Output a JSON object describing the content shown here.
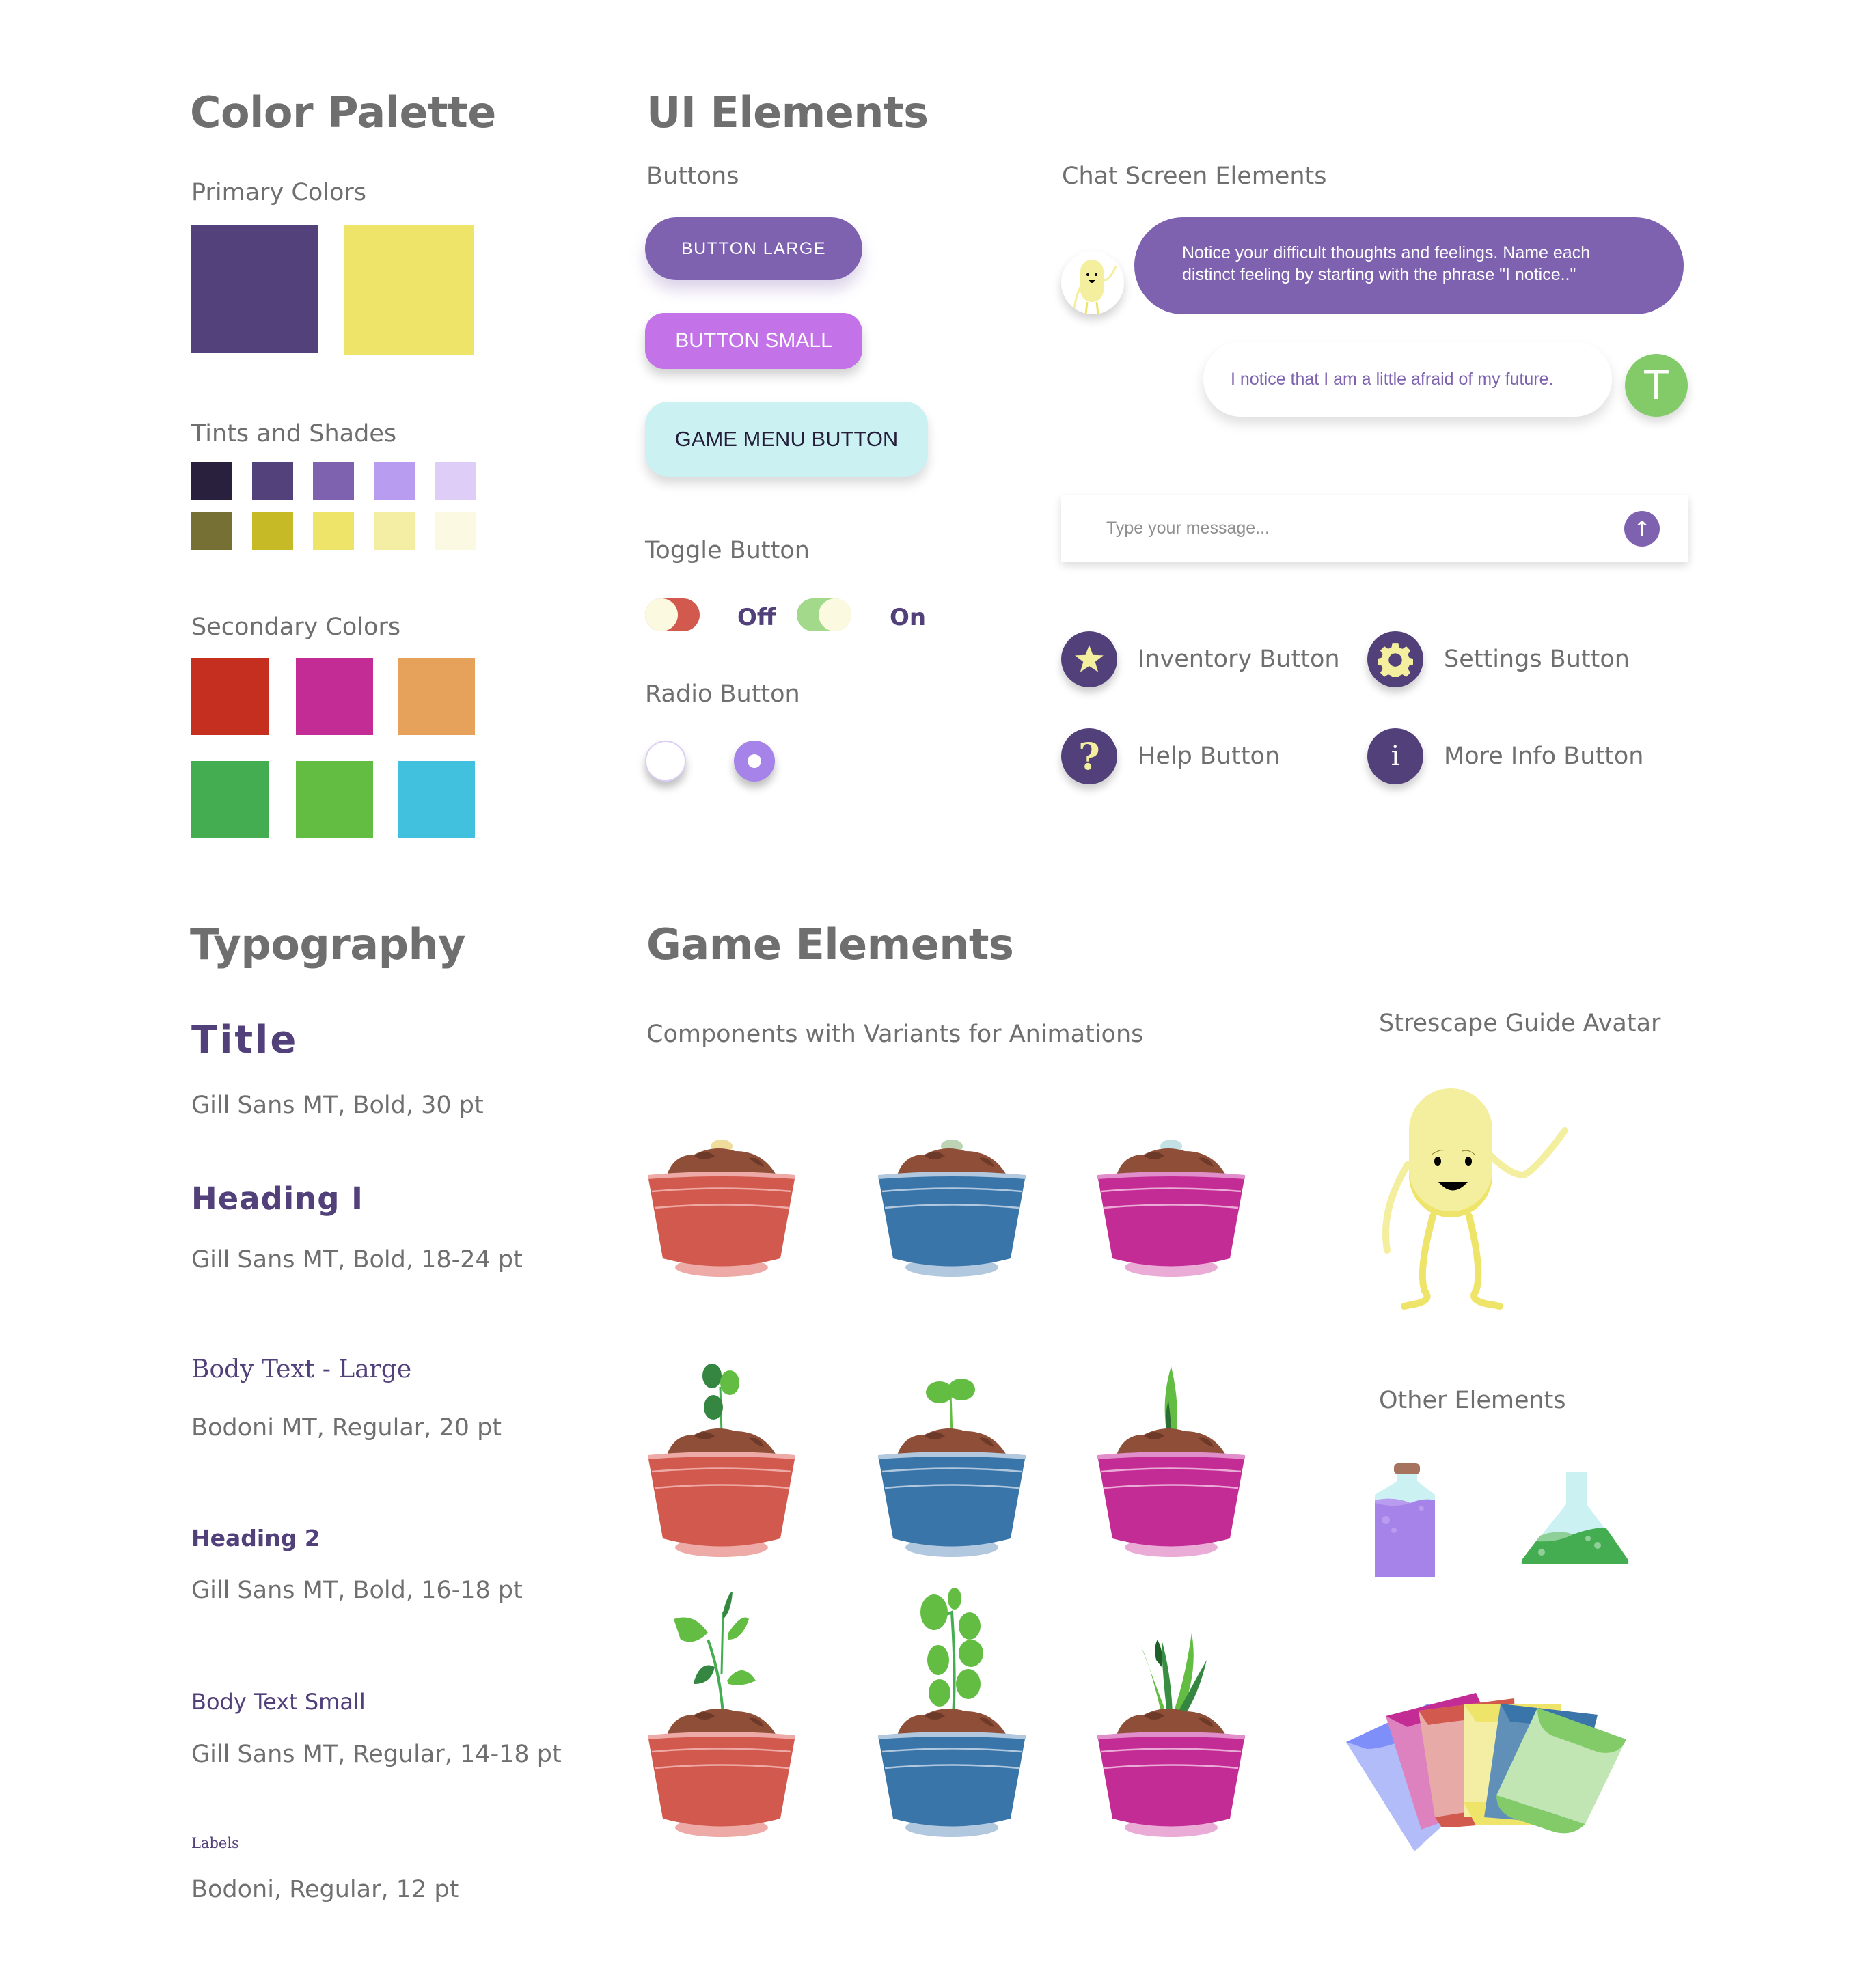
{
  "color_palette": {
    "title": "Color Palette",
    "primary": {
      "label": "Primary Colors",
      "colors": [
        "#52417a",
        "#efe46a"
      ]
    },
    "tints": {
      "label": "Tints and Shades",
      "purple": [
        "#28203c",
        "#52417a",
        "#7e62b0",
        "#b89cef",
        "#ddcdf7"
      ],
      "yellow": [
        "#777034",
        "#c6bb27",
        "#efe46a",
        "#f4eea4",
        "#fbf9e1"
      ]
    },
    "secondary": {
      "label": "Secondary Colors",
      "colors": [
        "#c52f20",
        "#c42c95",
        "#e6a15b",
        "#44ad51",
        "#63bd42",
        "#42c1df"
      ]
    }
  },
  "ui_elements": {
    "title": "UI Elements",
    "buttons": {
      "label": "Buttons",
      "large": "BUTTON LARGE",
      "small": "BUTTON SMALL",
      "game_menu": "GAME MENU BUTTON"
    },
    "toggle": {
      "label": "Toggle Button",
      "off_label": "Off",
      "on_label": "On"
    },
    "radio": {
      "label": "Radio Button"
    },
    "chat": {
      "label": "Chat Screen Elements",
      "bot_message": "Notice your difficult thoughts and feelings. Name each distinct feeling by starting with the phrase \"I notice..\"",
      "user_message": "I notice that I am a little afraid of my future.",
      "user_initial": "T",
      "input_placeholder": "Type your message...",
      "send_icon": "↑"
    },
    "icon_buttons": [
      {
        "label": "Inventory Button",
        "icon": "star-icon"
      },
      {
        "label": "Settings Button",
        "icon": "gear-icon"
      },
      {
        "label": "Help Button",
        "icon": "question-icon"
      },
      {
        "label": "More Info Button",
        "icon": "info-icon"
      }
    ]
  },
  "typography": {
    "title": "Typography",
    "items": [
      {
        "sample": "Title",
        "spec": "Gill Sans MT, Bold, 30 pt"
      },
      {
        "sample": "Heading I",
        "spec": "Gill Sans MT, Bold, 18-24 pt"
      },
      {
        "sample": "Body Text - Large",
        "spec": "Bodoni MT, Regular, 20 pt"
      },
      {
        "sample": "Heading 2",
        "spec": "Gill Sans MT, Bold, 16-18 pt"
      },
      {
        "sample": "Body Text Small",
        "spec": "Gill Sans MT, Regular, 14-18 pt"
      },
      {
        "sample": "Labels",
        "spec": "Bodoni, Regular, 12 pt"
      }
    ]
  },
  "game_elements": {
    "title": "Game Elements",
    "components_label": "Components with Variants for Animations",
    "pot_colors": [
      "#d2594d",
      "#3975a8",
      "#c42c95"
    ],
    "avatar_label": "Strescape Guide Avatar",
    "other_label": "Other Elements"
  }
}
